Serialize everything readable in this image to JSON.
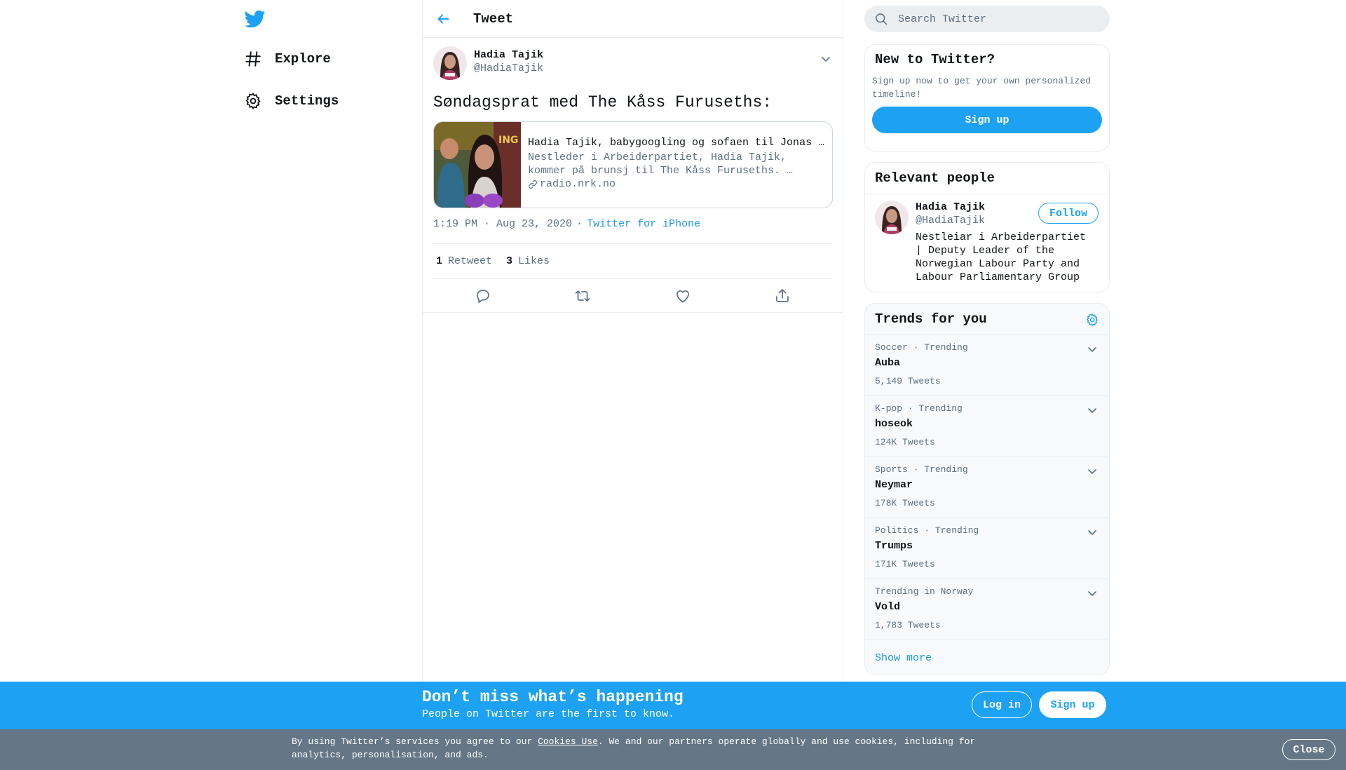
{
  "nav": {
    "logo_icon": "twitter-bird-icon",
    "items": [
      {
        "label": "Explore",
        "icon": "hashtag-icon"
      },
      {
        "label": "Settings",
        "icon": "gear-icon"
      }
    ]
  },
  "header": {
    "back_icon": "arrow-left-icon",
    "title": "Tweet"
  },
  "tweet": {
    "author_name": "Hadia Tajik",
    "author_handle": "@HadiaTajik",
    "text": "Søndagsprat med The Kåss Furuseths:",
    "card": {
      "title": "Hadia Tajik, babygoogling og sofaen til Jonas Gahr Støre",
      "description": "Nestleder i Arbeiderpartiet, Hadia Tajik, kommer på brunsj til The Kåss Furuseths. …",
      "link_icon": "link-icon",
      "domain": "radio.nrk.no"
    },
    "time": "1:19 PM · Aug 23, 2020",
    "separator": "·",
    "source": "Twitter for iPhone",
    "retweets_count": "1",
    "retweets_label": "Retweet",
    "likes_count": "3",
    "likes_label": "Likes",
    "actions": [
      "reply-icon",
      "retweet-icon",
      "like-icon",
      "share-icon"
    ]
  },
  "search": {
    "placeholder": "Search Twitter",
    "icon": "search-icon"
  },
  "new_to_twitter": {
    "title": "New to Twitter?",
    "text": "Sign up now to get your own personalized timeline!",
    "button": "Sign up"
  },
  "relevant_people": {
    "title": "Relevant people",
    "person": {
      "name": "Hadia Tajik",
      "handle": "@HadiaTajik",
      "bio": "Nestleiar i Arbeiderpartiet | Deputy Leader of the Norwegian Labour Party and Labour Parliamentary Group",
      "follow_label": "Follow"
    }
  },
  "trends": {
    "title": "Trends for you",
    "items": [
      {
        "context": "Soccer · Trending",
        "name": "Auba",
        "count": "5,149 Tweets"
      },
      {
        "context": "K-pop · Trending",
        "name": "hoseok",
        "count": "124K Tweets"
      },
      {
        "context": "Sports · Trending",
        "name": "Neymar",
        "count": "178K Tweets"
      },
      {
        "context": "Politics · Trending",
        "name": "Trumps",
        "count": "171K Tweets"
      },
      {
        "context": "Trending in Norway",
        "name": "Vold",
        "count": "1,783 Tweets"
      }
    ],
    "show_more": "Show more"
  },
  "banner": {
    "title": "Don’t miss what’s happening",
    "subtitle": "People on Twitter are the first to know.",
    "login": "Log in",
    "signup": "Sign up"
  },
  "cookie": {
    "text_before": "By using Twitter’s services you agree to our ",
    "link": "Cookies Use",
    "text_after": ". We and our partners operate globally and use cookies, including for analytics, personalisation, and ads.",
    "close": "Close"
  },
  "colors": {
    "brand": "#1da1f2",
    "link": "#1b95e0",
    "secondary_text": "#5b7083",
    "cookie_bar": "#657786"
  }
}
